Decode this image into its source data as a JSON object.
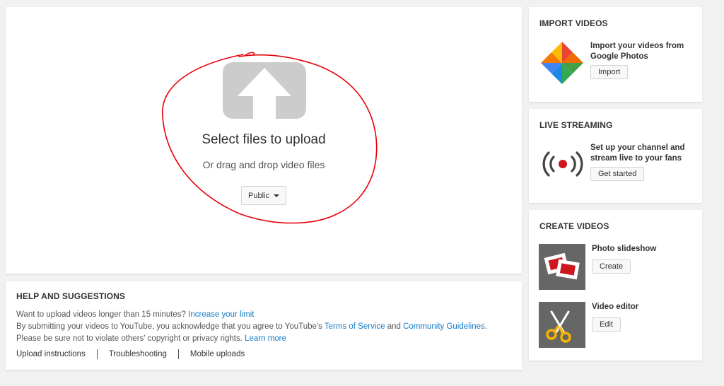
{
  "upload": {
    "title": "Select files to upload",
    "subtitle": "Or drag and drop video files",
    "privacy_selected": "Public"
  },
  "help": {
    "heading": "HELP AND SUGGESTIONS",
    "line1_text": "Want to upload videos longer than 15 minutes?",
    "line1_link": "Increase your limit",
    "line2_text": "By submitting your videos to YouTube, you acknowledge that you agree to YouTube's",
    "line2_link1": "Terms of Service",
    "line2_and": "and",
    "line2_link2": "Community Guidelines",
    "line2_end": ".",
    "line3_text": "Please be sure not to violate others' copyright or privacy rights.",
    "line3_link": "Learn more",
    "links": [
      "Upload instructions",
      "Troubleshooting",
      "Mobile uploads"
    ]
  },
  "import": {
    "heading": "IMPORT VIDEOS",
    "text": "Import your videos from Google Photos",
    "button": "Import",
    "icon": "google-photos-icon"
  },
  "live": {
    "heading": "LIVE STREAMING",
    "text": "Set up your channel and stream live to your fans",
    "button": "Get started",
    "icon": "live-broadcast-icon",
    "accent": "#cc181e"
  },
  "create": {
    "heading": "CREATE VIDEOS",
    "items": [
      {
        "label": "Photo slideshow",
        "button": "Create",
        "icon": "slideshow-icon"
      },
      {
        "label": "Video editor",
        "button": "Edit",
        "icon": "scissors-icon"
      }
    ]
  },
  "colors": {
    "link": "#167ac6",
    "annotation": "#e8000b",
    "upload_icon": "#cccccc"
  }
}
